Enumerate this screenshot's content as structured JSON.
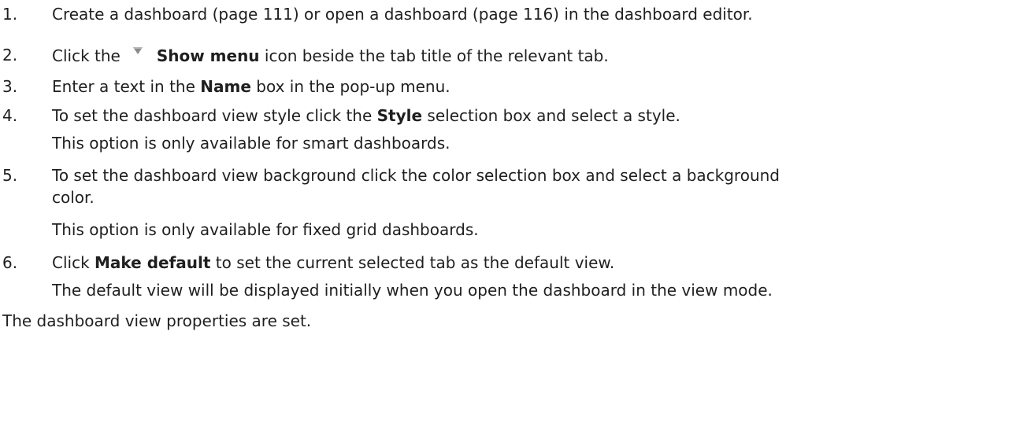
{
  "steps": [
    {
      "number": "1.",
      "text": "Create a dashboard (page 111) or open a dashboard (page 116) in the dashboard editor."
    },
    {
      "number": "2.",
      "before": "Click the",
      "icon": "show-menu-triangle-icon",
      "bold": "Show menu",
      "after": "icon beside the tab title of the relevant tab."
    },
    {
      "number": "3.",
      "before": "Enter a text in the",
      "bold": "Name",
      "after": "box in the pop-up menu."
    },
    {
      "number": "4.",
      "before": "To set the dashboard view style click the",
      "bold": "Style",
      "after": "selection box and select a style.",
      "note": "This option is only available for smart dashboards."
    },
    {
      "number": "5.",
      "text": "To set the dashboard view background click the color selection box and select a background",
      "continuation": "color.",
      "note": "This option is only available for fixed grid dashboards."
    },
    {
      "number": "6.",
      "before": "Click",
      "bold": "Make default",
      "after": "to set the current selected tab as the default view.",
      "note": "The default view will be displayed initially when you open the dashboard in the view mode."
    }
  ],
  "result": "The dashboard view properties are set.",
  "colors": {
    "text": "#1f1f1f",
    "icon": "#8a8a8a"
  }
}
